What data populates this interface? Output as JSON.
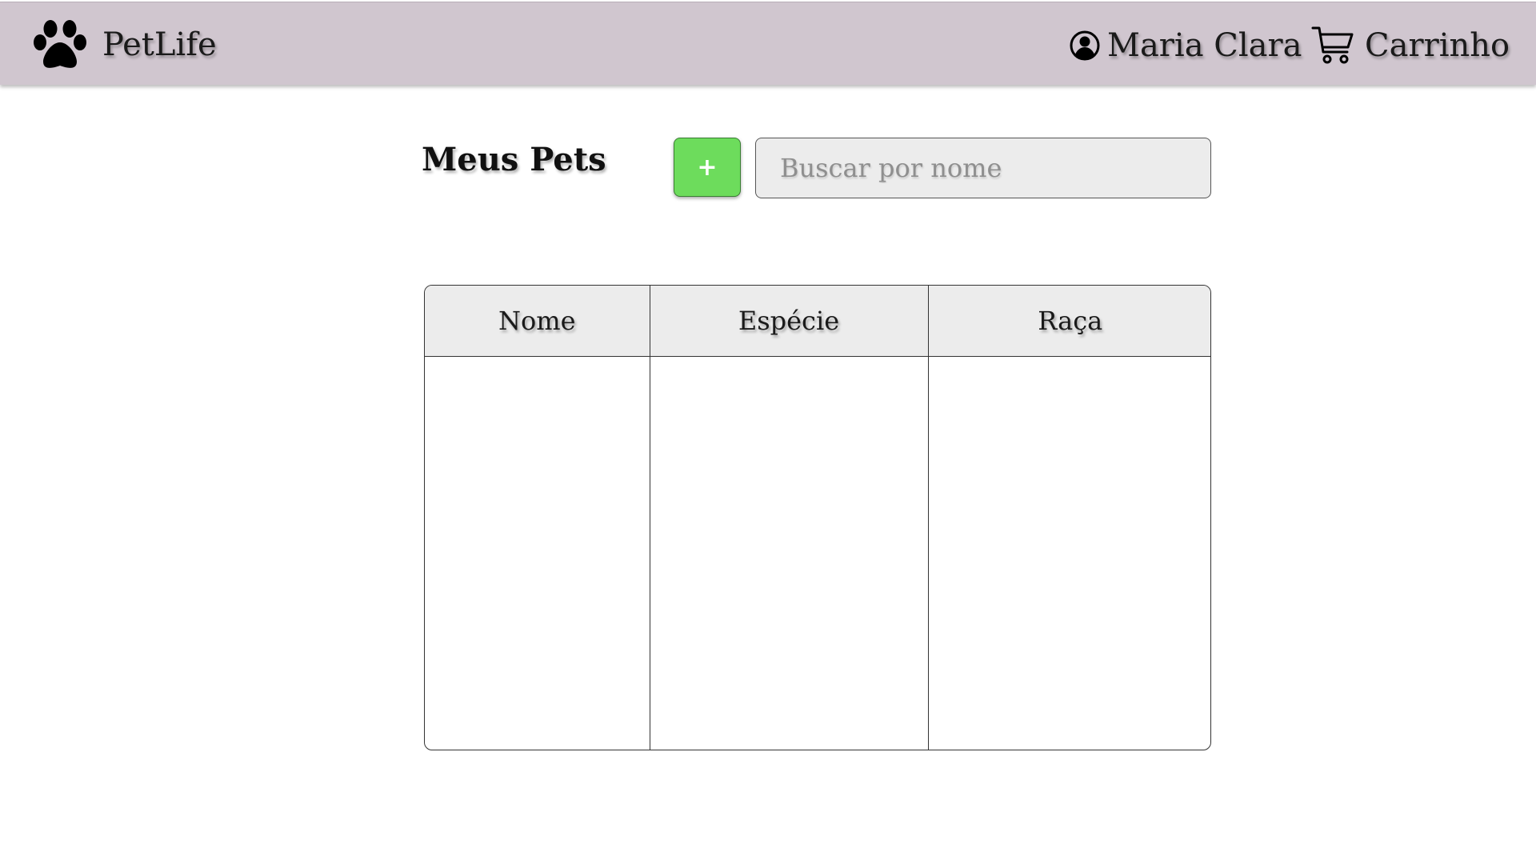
{
  "header": {
    "brand_name": "PetLife",
    "user_name": "Maria Clara",
    "cart_label": "Carrinho"
  },
  "main": {
    "title": "Meus Pets",
    "add_label": "+",
    "search": {
      "placeholder": "Buscar por nome",
      "value": ""
    },
    "table": {
      "columns": [
        "Nome",
        "Espécie",
        "Raça"
      ],
      "rows": []
    }
  },
  "colors": {
    "header_bg": "#d0c6cf",
    "add_button": "#6ddc5c",
    "input_bg": "#ececec"
  },
  "icons": {
    "brand": "paw-icon",
    "user": "user-circle-icon",
    "cart": "cart-icon"
  }
}
